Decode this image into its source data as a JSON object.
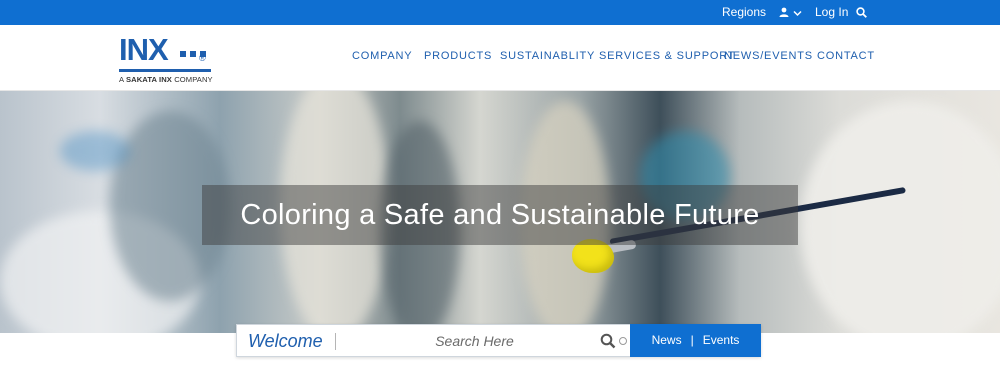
{
  "topbar": {
    "regions_label": "Regions",
    "login_label": "Log In",
    "user_icon": "user-icon",
    "search_icon": "search-icon",
    "color": "#0f6fd1"
  },
  "logo": {
    "wordmark": "INX",
    "registered": "®",
    "tagline_prefix": "A",
    "tagline_bold": "SAKATA INX",
    "tagline_suffix": "COMPANY"
  },
  "nav": {
    "items": [
      {
        "label": "COMPANY"
      },
      {
        "label": "PRODUCTS"
      },
      {
        "label": "SUSTAINABLITY"
      },
      {
        "label": "SERVICES & SUPPORT"
      },
      {
        "label": "NEWS/EVENTS"
      },
      {
        "label": "CONTACT"
      }
    ]
  },
  "hero": {
    "tagline": "Coloring a Safe and Sustainable Future"
  },
  "welcome_bar": {
    "welcome_label": "Welcome",
    "search_placeholder": "Search Here",
    "search_value": "",
    "news_label": "News",
    "separator": "|",
    "events_label": "Events"
  }
}
